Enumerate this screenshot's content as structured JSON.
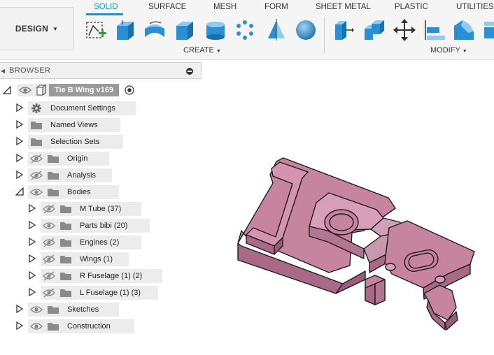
{
  "toolbar": {
    "design_label": "DESIGN",
    "tabs": [
      {
        "label": "SOLID",
        "active": true
      },
      {
        "label": "SURFACE",
        "active": false
      },
      {
        "label": "MESH",
        "active": false
      },
      {
        "label": "FORM",
        "active": false
      },
      {
        "label": "SHEET METAL",
        "active": false
      },
      {
        "label": "PLASTIC",
        "active": false
      },
      {
        "label": "UTILITIES",
        "active": false
      }
    ],
    "create_label": "CREATE",
    "modify_label": "MODIFY",
    "create_tools": [
      "create-sketch-icon",
      "extrude-icon",
      "revolve-icon",
      "box-icon",
      "cylinder-icon",
      "pattern-icon",
      "mirror-icon",
      "sphere-icon"
    ],
    "modify_tools": [
      "press-pull-icon",
      "combine-icon",
      "move-icon",
      "align-icon",
      "chamfer-icon",
      "shell-icon"
    ],
    "accent_color": "#0696d7"
  },
  "browser": {
    "title": "BROWSER",
    "root": {
      "label": "Tie B Wing v169"
    },
    "items": [
      {
        "label": "Document Settings",
        "icon": "gear-icon"
      },
      {
        "label": "Named Views",
        "icon": "folder-icon"
      },
      {
        "label": "Selection Sets",
        "icon": "folder-icon"
      },
      {
        "label": "Origin",
        "icon": "folder-icon",
        "visibility": "hidden"
      },
      {
        "label": "Analysis",
        "icon": "folder-icon",
        "visibility": "hidden"
      },
      {
        "label": "Bodies",
        "icon": "folder-icon",
        "visibility": "visible",
        "expanded": true
      },
      {
        "label": "M Tube (37)",
        "icon": "folder-icon",
        "visibility": "hidden"
      },
      {
        "label": "Parts bibi (20)",
        "icon": "folder-icon",
        "visibility": "visible"
      },
      {
        "label": "Engines (2)",
        "icon": "folder-icon",
        "visibility": "hidden"
      },
      {
        "label": "Wings (1)",
        "icon": "folder-icon",
        "visibility": "hidden"
      },
      {
        "label": "R Fuselage (1) (2)",
        "icon": "folder-icon",
        "visibility": "hidden"
      },
      {
        "label": "L Fuselage (1) (3)",
        "icon": "folder-icon",
        "visibility": "hidden"
      },
      {
        "label": "Sketches",
        "icon": "folder-icon",
        "visibility": "visible"
      },
      {
        "label": "Construction",
        "icon": "folder-icon",
        "visibility": "visible"
      }
    ]
  },
  "model": {
    "body_color": "#c88aa3"
  }
}
